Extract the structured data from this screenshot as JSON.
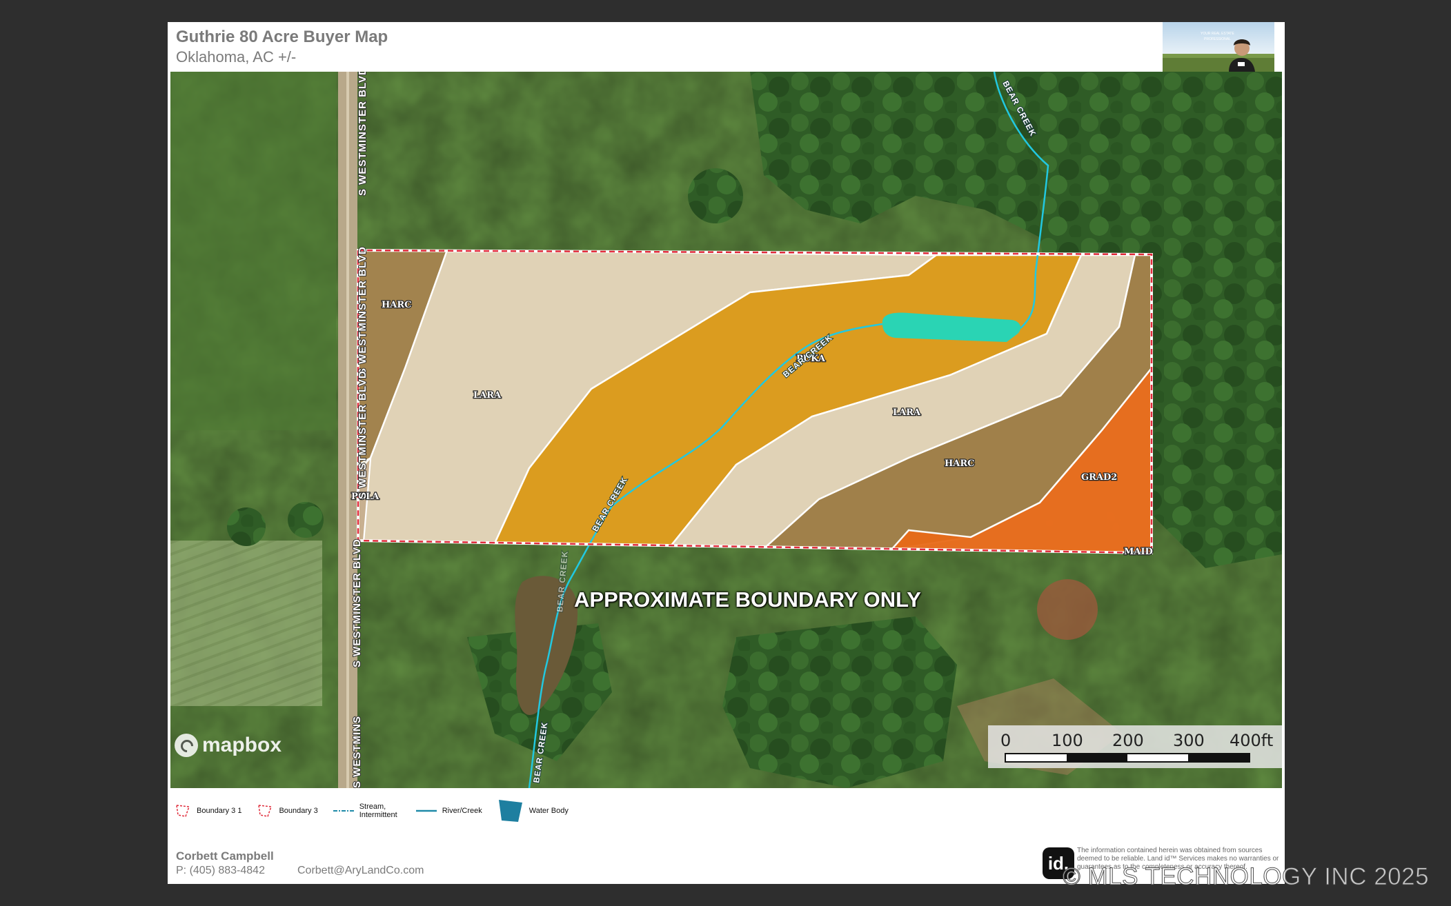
{
  "header": {
    "title": "Guthrie 80 Acre Buyer Map",
    "subtitle": "Oklahoma,  AC +/-",
    "agent_photo_text": [
      "YOUR REAL ESTATE",
      "PROFESSIONAL"
    ]
  },
  "map": {
    "soil_labels": [
      {
        "text": "HARC"
      },
      {
        "text": "LARA"
      },
      {
        "text": "PUKA"
      },
      {
        "text": "LARA"
      },
      {
        "text": "HARC"
      },
      {
        "text": "GRAD2"
      },
      {
        "text": "PULA"
      },
      {
        "text": "MAID"
      }
    ],
    "road_labels": [
      "S WESTMINSTER BLVD",
      "S WESTMINSTER BLVD",
      "S WESTMINSTER BLVD",
      "S WESTMINSTER BLVD",
      "S WESTMINS"
    ],
    "creek_labels": [
      "BEAR CREEK",
      "BEAR CREEK",
      "BEAR CREEK",
      "BEAR CREEK",
      "BEAR CREEK"
    ],
    "overlay_text": "APPROXIMATE BOUNDARY ONLY",
    "attribution": "mapbox",
    "scale": {
      "labels": [
        "0",
        "100",
        "200",
        "300",
        "400ft"
      ]
    },
    "colors": {
      "pasture": "#5f8a40",
      "trees": "#2b5a24",
      "harc": "#a0804a",
      "lara": "#e0d2b6",
      "puka": "#dc9a18",
      "grad2": "#e86a18",
      "water_body": "#2ad4b4",
      "creek": "#22c8e0",
      "boundary": "#e02a3a"
    }
  },
  "legend": {
    "items": [
      {
        "label": "Boundary 3 1",
        "icon": "boundary-outline-icon"
      },
      {
        "label": "Boundary 3",
        "icon": "boundary-outline-icon"
      },
      {
        "label": "Stream, Intermittent",
        "icon": "stream-intermittent-icon"
      },
      {
        "label": "River/Creek",
        "icon": "river-creek-icon"
      },
      {
        "label": "Water Body",
        "icon": "water-body-icon"
      }
    ]
  },
  "footer": {
    "agent_name": "Corbett Campbell",
    "phone": "P: (405) 883-4842",
    "email": "Corbett@AryLandCo.com",
    "logo_text": "id.",
    "disclaimer": "The information contained herein was obtained from sources deemed to be reliable. Land id™ Services makes no warranties or guarantees as to the completeness or accuracy thereof."
  },
  "watermark": "© MLS TECHNOLOGY INC 2025"
}
